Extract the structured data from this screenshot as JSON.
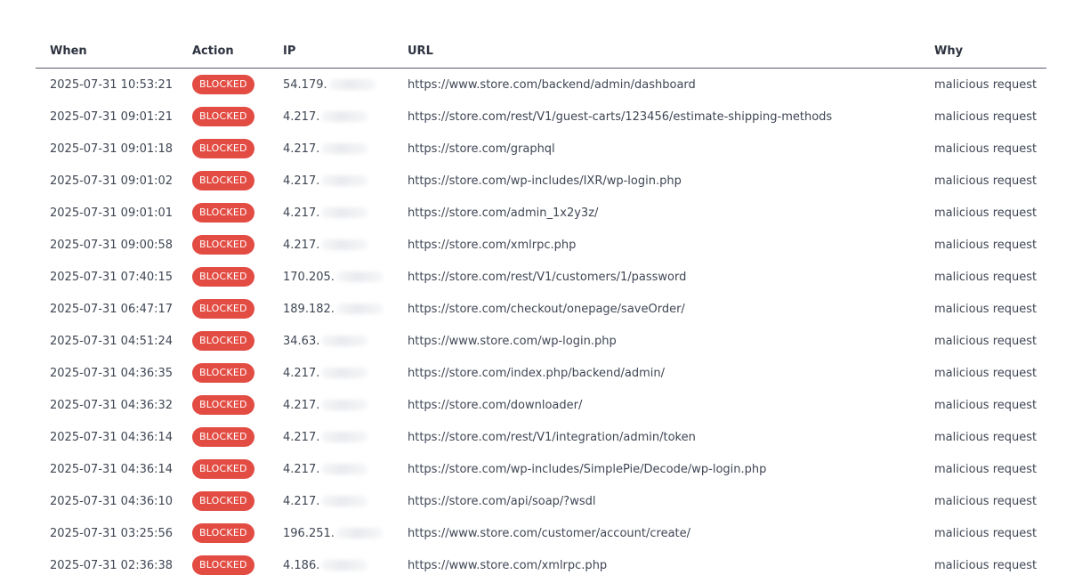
{
  "table": {
    "headers": {
      "when": "When",
      "action": "Action",
      "ip": "IP",
      "url": "URL",
      "why": "Why"
    },
    "badge_color": "#e24c43",
    "rows": [
      {
        "when": "2025-07-31 10:53:21",
        "action": "BLOCKED",
        "ip": "54.179.",
        "url": "https://www.store.com/backend/admin/dashboard",
        "why": "malicious request"
      },
      {
        "when": "2025-07-31 09:01:21",
        "action": "BLOCKED",
        "ip": "4.217.",
        "url": "https://store.com/rest/V1/guest-carts/123456/estimate-shipping-methods",
        "why": "malicious request"
      },
      {
        "when": "2025-07-31 09:01:18",
        "action": "BLOCKED",
        "ip": "4.217.",
        "url": "https://store.com/graphql",
        "why": "malicious request"
      },
      {
        "when": "2025-07-31 09:01:02",
        "action": "BLOCKED",
        "ip": "4.217.",
        "url": "https://store.com/wp-includes/IXR/wp-login.php",
        "why": "malicious request"
      },
      {
        "when": "2025-07-31 09:01:01",
        "action": "BLOCKED",
        "ip": "4.217.",
        "url": "https://store.com/admin_1x2y3z/",
        "why": "malicious request"
      },
      {
        "when": "2025-07-31 09:00:58",
        "action": "BLOCKED",
        "ip": "4.217.",
        "url": "https://store.com/xmlrpc.php",
        "why": "malicious request"
      },
      {
        "when": "2025-07-31 07:40:15",
        "action": "BLOCKED",
        "ip": "170.205.",
        "url": "https://store.com/rest/V1/customers/1/password",
        "why": "malicious request"
      },
      {
        "when": "2025-07-31 06:47:17",
        "action": "BLOCKED",
        "ip": "189.182.",
        "url": "https://store.com/checkout/onepage/saveOrder/",
        "why": "malicious request"
      },
      {
        "when": "2025-07-31 04:51:24",
        "action": "BLOCKED",
        "ip": "34.63.",
        "url": "https://www.store.com/wp-login.php",
        "why": "malicious request"
      },
      {
        "when": "2025-07-31 04:36:35",
        "action": "BLOCKED",
        "ip": "4.217.",
        "url": "https://store.com/index.php/backend/admin/",
        "why": "malicious request"
      },
      {
        "when": "2025-07-31 04:36:32",
        "action": "BLOCKED",
        "ip": "4.217.",
        "url": "https://store.com/downloader/",
        "why": "malicious request"
      },
      {
        "when": "2025-07-31 04:36:14",
        "action": "BLOCKED",
        "ip": "4.217.",
        "url": "https://store.com/rest/V1/integration/admin/token",
        "why": "malicious request"
      },
      {
        "when": "2025-07-31 04:36:14",
        "action": "BLOCKED",
        "ip": "4.217.",
        "url": "https://store.com/wp-includes/SimplePie/Decode/wp-login.php",
        "why": "malicious request"
      },
      {
        "when": "2025-07-31 04:36:10",
        "action": "BLOCKED",
        "ip": "4.217.",
        "url": "https://store.com/api/soap/?wsdl",
        "why": "malicious request"
      },
      {
        "when": "2025-07-31 03:25:56",
        "action": "BLOCKED",
        "ip": "196.251.",
        "url": "https://www.store.com/customer/account/create/",
        "why": "malicious request"
      },
      {
        "when": "2025-07-31 02:36:38",
        "action": "BLOCKED",
        "ip": "4.186.",
        "url": "https://www.store.com/xmlrpc.php",
        "why": "malicious request"
      }
    ]
  }
}
